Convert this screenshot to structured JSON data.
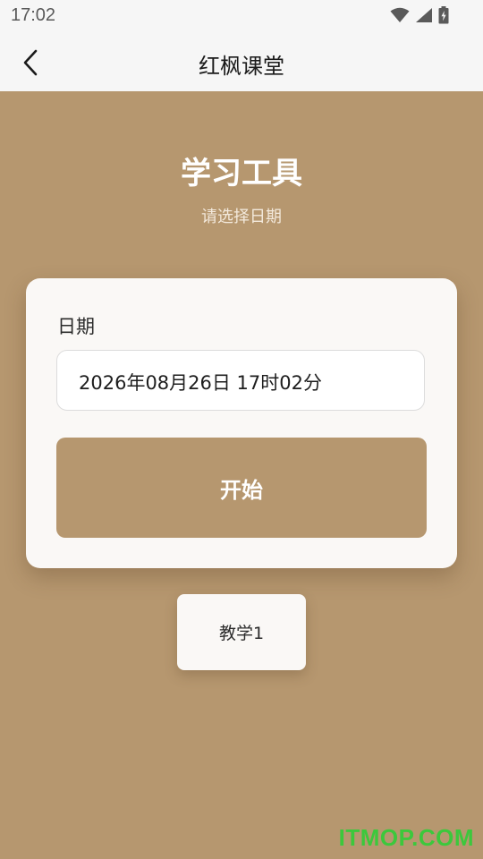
{
  "status_bar": {
    "time": "17:02",
    "icons": [
      "wifi-icon",
      "signal-icon",
      "battery-charging-icon"
    ]
  },
  "app_bar": {
    "back_icon": "chevron-left-icon",
    "title": "红枫课堂"
  },
  "header": {
    "title": "学习工具",
    "subtitle": "请选择日期"
  },
  "form": {
    "date_label": "日期",
    "date_value": "2026年08月26日 17时02分",
    "start_label": "开始"
  },
  "teach_button": {
    "label": "教学1"
  },
  "watermark": {
    "text": "ITMOP.COM"
  },
  "colors": {
    "background": "#b6976f",
    "card": "#faf8f6",
    "app_bar": "#f6f6f6",
    "watermark": "#3cc83c"
  }
}
